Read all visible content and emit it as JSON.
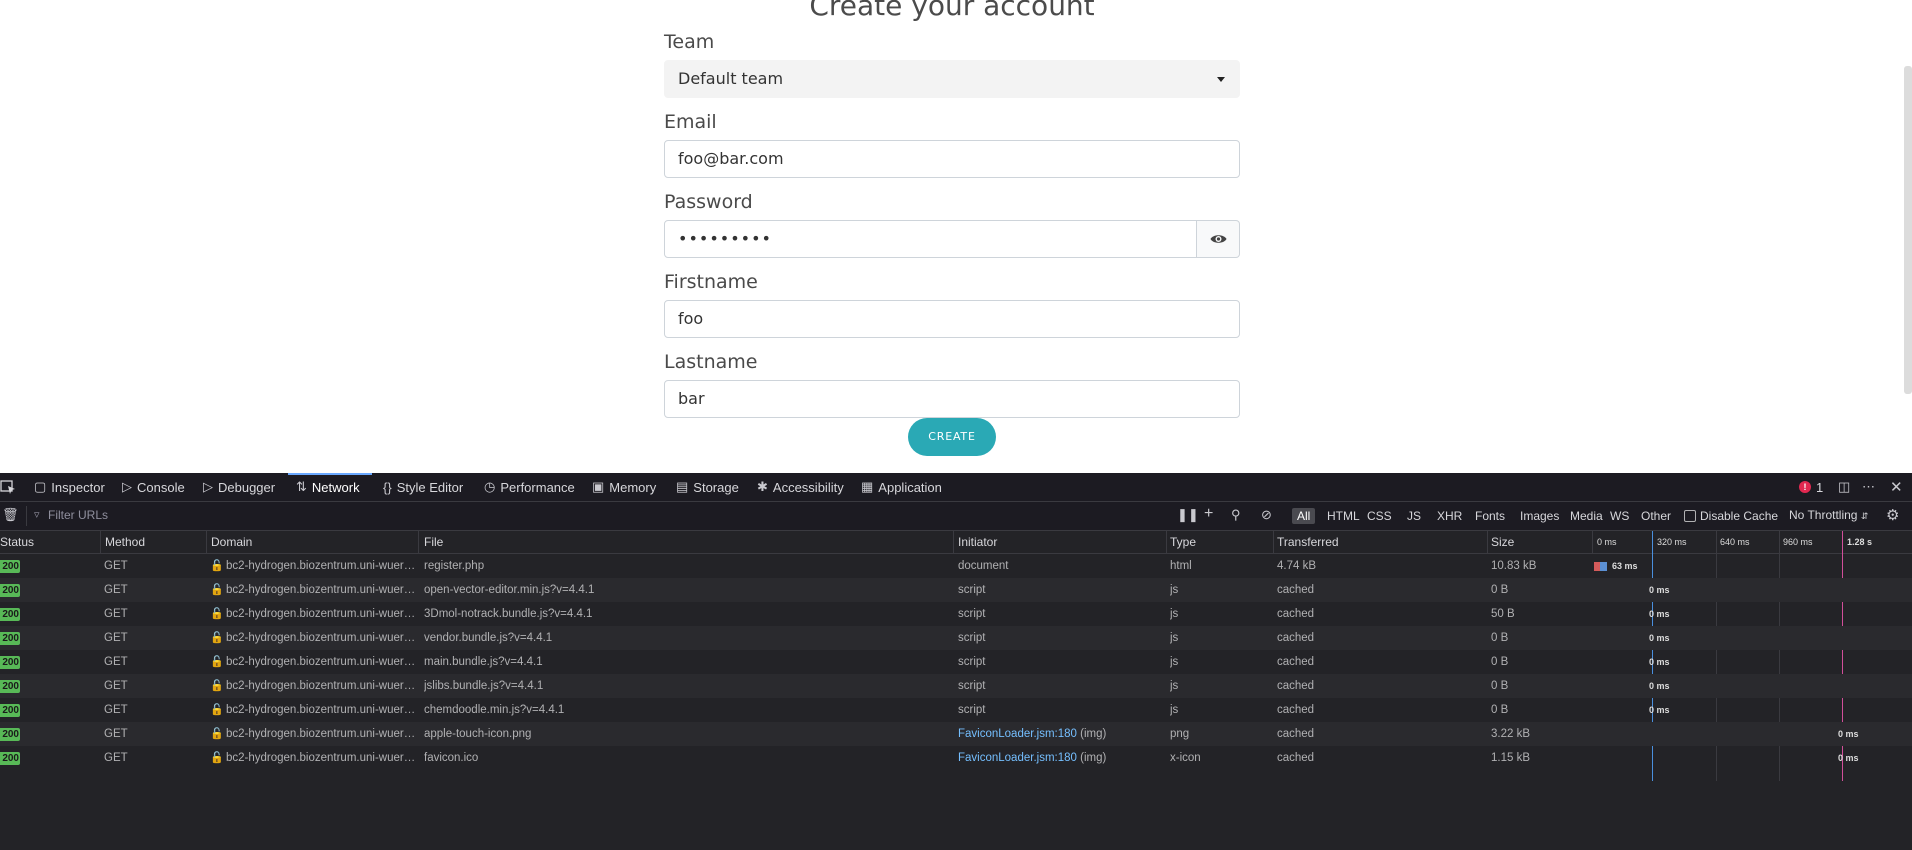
{
  "page": {
    "title": "Create your account",
    "team_label": "Team",
    "team_value": "Default team",
    "email_label": "Email",
    "email_value": "foo@bar.com",
    "password_label": "Password",
    "password_value": "•••••••••",
    "firstname_label": "Firstname",
    "firstname_value": "foo",
    "lastname_label": "Lastname",
    "lastname_value": "bar",
    "create_label": "CREATE"
  },
  "devtools": {
    "tabs": [
      "Inspector",
      "Console",
      "Debugger",
      "Network",
      "Style Editor",
      "Performance",
      "Memory",
      "Storage",
      "Accessibility",
      "Application"
    ],
    "active_tab": "Network",
    "error_count": "1",
    "filter_placeholder": "Filter URLs",
    "type_filters": [
      "All",
      "HTML",
      "CSS",
      "JS",
      "XHR",
      "Fonts",
      "Images",
      "Media",
      "WS",
      "Other"
    ],
    "disable_cache_label": "Disable Cache",
    "throttling_label": "No Throttling",
    "columns": [
      "Status",
      "Method",
      "Domain",
      "File",
      "Initiator",
      "Type",
      "Transferred",
      "Size"
    ],
    "timeline_ticks": [
      "0 ms",
      "320 ms",
      "640 ms",
      "960 ms",
      "1.28 s"
    ],
    "requests": [
      {
        "status": "200",
        "method": "GET",
        "domain": "bc2-hydrogen.biozentrum.uni-wuer…",
        "file": "register.php",
        "initiator": "document",
        "initiator_extra": "",
        "type": "html",
        "transferred": "4.74 kB",
        "size": "10.83 kB",
        "timing": "63 ms"
      },
      {
        "status": "200",
        "method": "GET",
        "domain": "bc2-hydrogen.biozentrum.uni-wuer…",
        "file": "open-vector-editor.min.js?v=4.4.1",
        "initiator": "script",
        "initiator_extra": "",
        "type": "js",
        "transferred": "cached",
        "size": "0 B",
        "timing": "0 ms"
      },
      {
        "status": "200",
        "method": "GET",
        "domain": "bc2-hydrogen.biozentrum.uni-wuer…",
        "file": "3Dmol-notrack.bundle.js?v=4.4.1",
        "initiator": "script",
        "initiator_extra": "",
        "type": "js",
        "transferred": "cached",
        "size": "50 B",
        "timing": "0 ms"
      },
      {
        "status": "200",
        "method": "GET",
        "domain": "bc2-hydrogen.biozentrum.uni-wuer…",
        "file": "vendor.bundle.js?v=4.4.1",
        "initiator": "script",
        "initiator_extra": "",
        "type": "js",
        "transferred": "cached",
        "size": "0 B",
        "timing": "0 ms"
      },
      {
        "status": "200",
        "method": "GET",
        "domain": "bc2-hydrogen.biozentrum.uni-wuer…",
        "file": "main.bundle.js?v=4.4.1",
        "initiator": "script",
        "initiator_extra": "",
        "type": "js",
        "transferred": "cached",
        "size": "0 B",
        "timing": "0 ms"
      },
      {
        "status": "200",
        "method": "GET",
        "domain": "bc2-hydrogen.biozentrum.uni-wuer…",
        "file": "jslibs.bundle.js?v=4.4.1",
        "initiator": "script",
        "initiator_extra": "",
        "type": "js",
        "transferred": "cached",
        "size": "0 B",
        "timing": "0 ms"
      },
      {
        "status": "200",
        "method": "GET",
        "domain": "bc2-hydrogen.biozentrum.uni-wuer…",
        "file": "chemdoodle.min.js?v=4.4.1",
        "initiator": "script",
        "initiator_extra": "",
        "type": "js",
        "transferred": "cached",
        "size": "0 B",
        "timing": "0 ms"
      },
      {
        "status": "200",
        "method": "GET",
        "domain": "bc2-hydrogen.biozentrum.uni-wuer…",
        "file": "apple-touch-icon.png",
        "initiator": "FaviconLoader.jsm:180",
        "initiator_extra": "(img)",
        "type": "png",
        "transferred": "cached",
        "size": "3.22 kB",
        "timing": "0 ms"
      },
      {
        "status": "200",
        "method": "GET",
        "domain": "bc2-hydrogen.biozentrum.uni-wuer…",
        "file": "favicon.ico",
        "initiator": "FaviconLoader.jsm:180",
        "initiator_extra": "(img)",
        "type": "x-icon",
        "transferred": "cached",
        "size": "1.15 kB",
        "timing": "0 ms"
      }
    ]
  }
}
